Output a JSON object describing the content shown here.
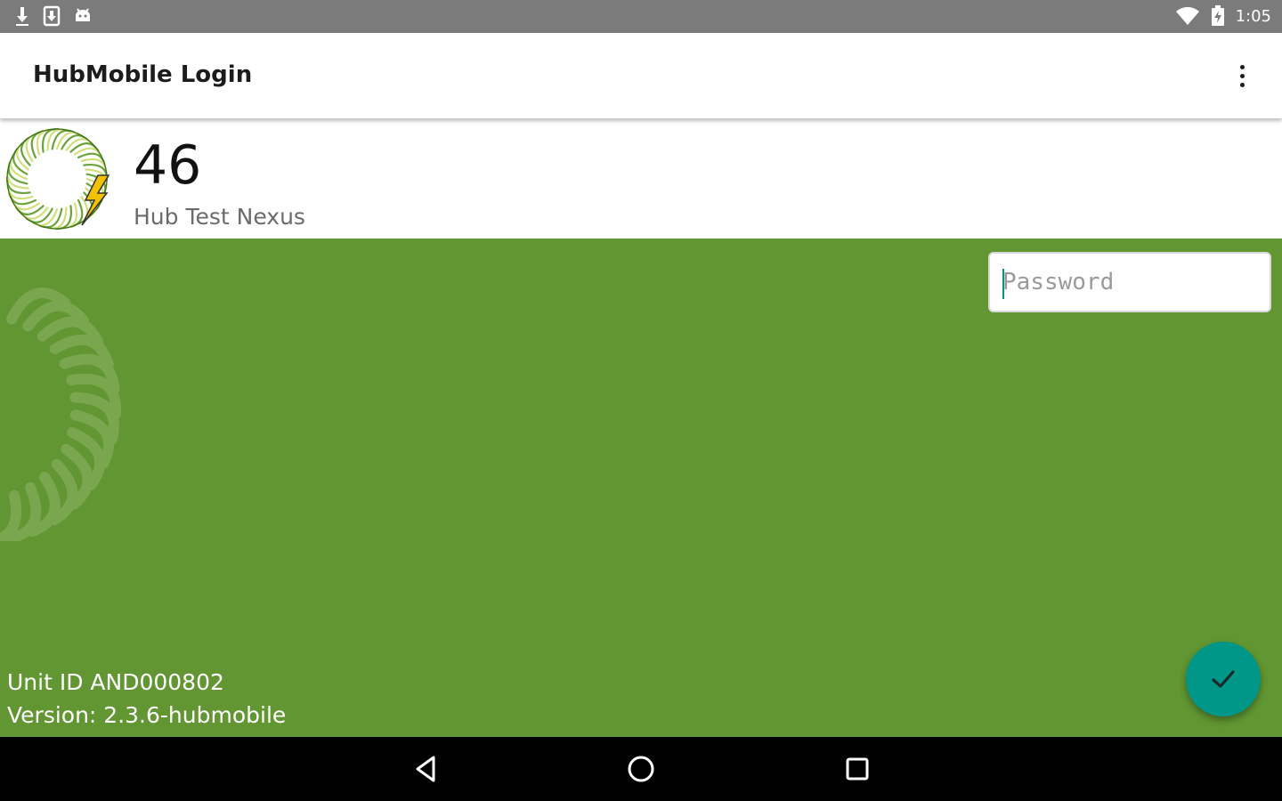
{
  "status_bar": {
    "time": "1:05",
    "left_icons": [
      "download-icon",
      "sim-icon",
      "android-icon"
    ],
    "right_icons": [
      "wifi-icon",
      "battery-icon"
    ]
  },
  "app_bar": {
    "title": "HubMobile Login",
    "overflow_icon": "more-vert-icon"
  },
  "hub": {
    "number": "46",
    "name": "Hub Test Nexus",
    "logo_icon": "hub-spiral-logo-icon"
  },
  "login": {
    "password_placeholder": "Password",
    "password_value": "",
    "submit_icon": "check-icon"
  },
  "footer_info": {
    "unit_id": "Unit ID AND000802",
    "version": "Version: 2.3.6-hubmobile"
  },
  "nav_bar": {
    "back_icon": "back-triangle-icon",
    "home_icon": "home-circle-icon",
    "recents_icon": "recents-square-icon"
  },
  "colors": {
    "status_bar": "#7b7b7b",
    "primary_green": "#619632",
    "accent_teal": "#009688",
    "nav_bar": "#000000"
  }
}
